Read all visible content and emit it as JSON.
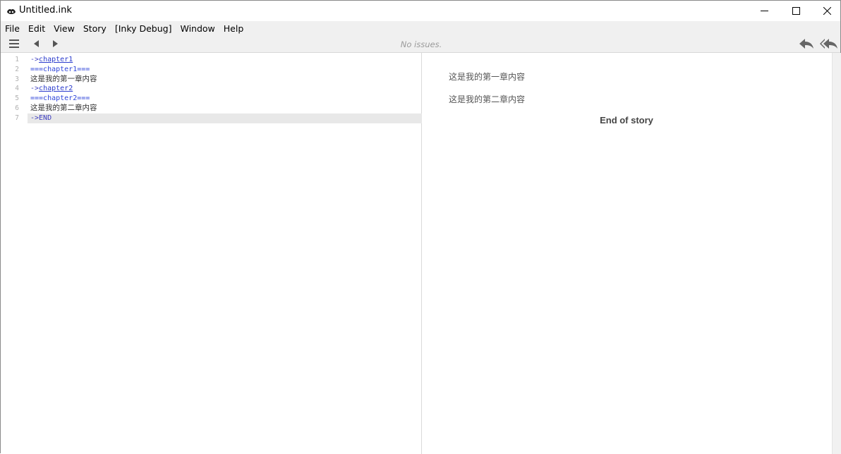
{
  "window": {
    "title": "Untitled.ink"
  },
  "menubar": {
    "items": [
      "File",
      "Edit",
      "View",
      "Story",
      "[Inky Debug]",
      "Window",
      "Help"
    ]
  },
  "toolbar": {
    "status": "No issues.",
    "icons": [
      "menu-icon",
      "back-arrow-icon",
      "forward-arrow-icon",
      "rewind-icon",
      "rewind-all-icon"
    ]
  },
  "editor": {
    "lines": [
      {
        "num": "1",
        "parts": [
          {
            "t": "->",
            "k": "arrow"
          },
          {
            "t": "chapter1",
            "k": "link"
          }
        ]
      },
      {
        "num": "2",
        "parts": [
          {
            "t": "===chapter1===",
            "k": "knot"
          }
        ]
      },
      {
        "num": "3",
        "parts": [
          {
            "t": "这是我的第一章内容",
            "k": "text"
          }
        ]
      },
      {
        "num": "4",
        "parts": [
          {
            "t": "->",
            "k": "arrow"
          },
          {
            "t": "chapter2",
            "k": "link"
          }
        ]
      },
      {
        "num": "5",
        "parts": [
          {
            "t": "===chapter2===",
            "k": "knot"
          }
        ]
      },
      {
        "num": "6",
        "parts": [
          {
            "t": "这是我的第二章内容",
            "k": "text"
          }
        ]
      },
      {
        "num": "7",
        "parts": [
          {
            "t": "->END",
            "k": "arrow"
          }
        ]
      }
    ]
  },
  "player": {
    "paragraphs": [
      "这是我的第一章内容",
      "这是我的第二章内容"
    ],
    "end_text": "End of story"
  }
}
